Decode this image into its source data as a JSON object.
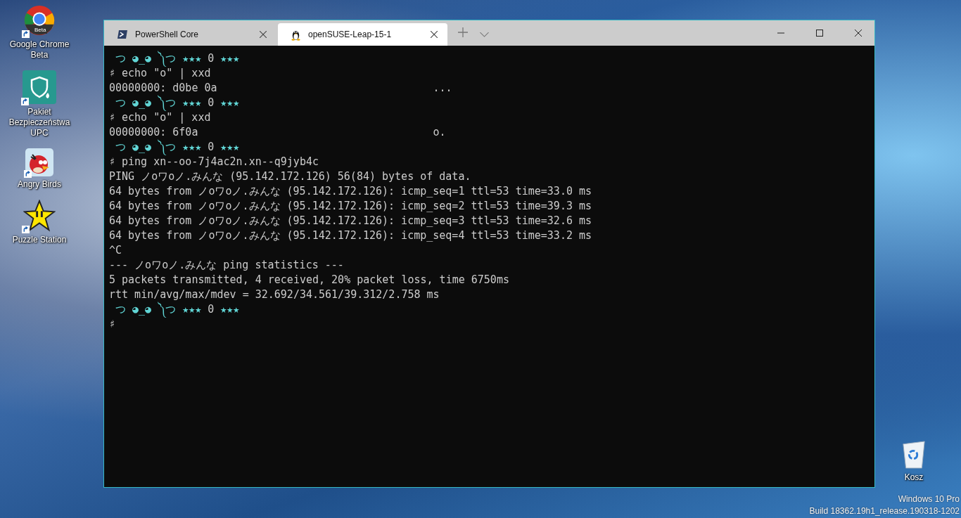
{
  "desktop_icons": [
    {
      "kind": "chrome",
      "label": "Google Chrome Beta",
      "badge": "Beta"
    },
    {
      "kind": "shield",
      "label": "Pakiet Bezpieczeństwa UPC"
    },
    {
      "kind": "bird",
      "label": "Angry Birds"
    },
    {
      "kind": "star",
      "label": "Puzzle Station"
    }
  ],
  "recycle_bin": {
    "label": "Kosz"
  },
  "window": {
    "tabs": [
      {
        "label": "PowerShell Core",
        "kind": "powershell",
        "selected": false
      },
      {
        "label": "openSUSE-Leap-15-1",
        "kind": "penguin",
        "selected": true
      }
    ]
  },
  "terminal": {
    "lines": [
      {
        "kind": "prompt",
        "segments": [
          {
            "text": "つ ◕_◕ ༽つ",
            "color": "#61d6d6"
          },
          {
            "text": "★★★",
            "color": "#61d6d6"
          },
          {
            "text": "0",
            "color": "#cccccc"
          },
          {
            "text": "★★★",
            "color": "#61d6d6"
          }
        ]
      },
      {
        "kind": "command",
        "sigil": "♯",
        "text": "echo \"o\" | xxd"
      },
      {
        "kind": "hexdump",
        "hex": "00000000: d0be 0a",
        "ascii": "..."
      },
      {
        "kind": "prompt",
        "segments": [
          {
            "text": "つ ◕_◕ ༽つ",
            "color": "#61d6d6"
          },
          {
            "text": "★★★",
            "color": "#61d6d6"
          },
          {
            "text": "0",
            "color": "#cccccc"
          },
          {
            "text": "★★★",
            "color": "#61d6d6"
          }
        ]
      },
      {
        "kind": "command",
        "sigil": "♯",
        "text": "echo \"o\" | xxd"
      },
      {
        "kind": "hexdump",
        "hex": "00000000: 6f0a",
        "ascii": "o."
      },
      {
        "kind": "prompt",
        "segments": [
          {
            "text": "つ ◕_◕ ༽つ",
            "color": "#61d6d6"
          },
          {
            "text": "★★★",
            "color": "#61d6d6"
          },
          {
            "text": "0",
            "color": "#cccccc"
          },
          {
            "text": "★★★",
            "color": "#61d6d6"
          }
        ]
      },
      {
        "kind": "command",
        "sigil": "♯",
        "text": "ping xn--oo-7j4ac2n.xn--q9jyb4c"
      },
      {
        "kind": "output",
        "text": "PING ノoワoノ.みんな (95.142.172.126) 56(84) bytes of data."
      },
      {
        "kind": "output",
        "text": "64 bytes from ノoワoノ.みんな (95.142.172.126): icmp_seq=1 ttl=53 time=33.0 ms"
      },
      {
        "kind": "output",
        "text": "64 bytes from ノoワoノ.みんな (95.142.172.126): icmp_seq=2 ttl=53 time=39.3 ms"
      },
      {
        "kind": "output",
        "text": "64 bytes from ノoワoノ.みんな (95.142.172.126): icmp_seq=3 ttl=53 time=32.6 ms"
      },
      {
        "kind": "output",
        "text": "64 bytes from ノoワoノ.みんな (95.142.172.126): icmp_seq=4 ttl=53 time=33.2 ms"
      },
      {
        "kind": "output",
        "text": "^C"
      },
      {
        "kind": "output",
        "text": "--- ノoワoノ.みんな ping statistics ---"
      },
      {
        "kind": "output",
        "text": "5 packets transmitted, 4 received, 20% packet loss, time 6750ms"
      },
      {
        "kind": "output",
        "text": "rtt min/avg/max/mdev = 32.692/34.561/39.312/2.758 ms"
      },
      {
        "kind": "prompt",
        "segments": [
          {
            "text": "つ ◕_◕ ༽つ",
            "color": "#61d6d6"
          },
          {
            "text": "★★★",
            "color": "#61d6d6"
          },
          {
            "text": "0",
            "color": "#cccccc"
          },
          {
            "text": "★★★",
            "color": "#61d6d6"
          }
        ]
      },
      {
        "kind": "command",
        "sigil": "♯"
      }
    ]
  },
  "watermark": {
    "edition": "Windows 10 Pro",
    "build": "Build 18362.19h1_release.190318-1202"
  }
}
